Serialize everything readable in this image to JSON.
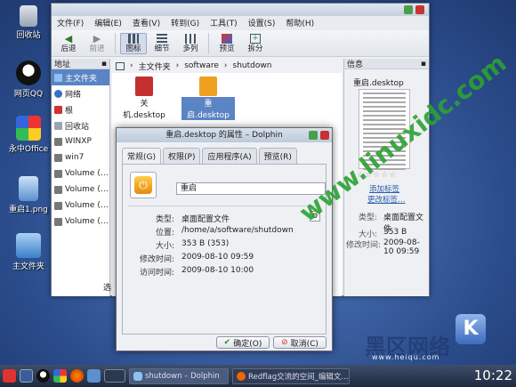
{
  "desktop": {
    "icons": [
      {
        "label": "回收站"
      },
      {
        "label": "网页QQ"
      },
      {
        "label": "永中Office"
      },
      {
        "label": "重启1.png"
      },
      {
        "label": "主文件夹"
      }
    ]
  },
  "window": {
    "menu": [
      "文件(F)",
      "编辑(E)",
      "查看(V)",
      "转到(G)",
      "工具(T)",
      "设置(S)",
      "帮助(H)"
    ],
    "toolbar": [
      "后退",
      "前进",
      "图标",
      "细节",
      "多列",
      "预览",
      "拆分"
    ],
    "places_title": "地址",
    "places": [
      "主文件夹",
      "网络",
      "根",
      "回收站",
      "WINXP",
      "win7",
      "Volume (…",
      "Volume (…",
      "Volume (…",
      "Volume (…"
    ],
    "breadcrumb": [
      "主文件夹",
      "software",
      "shutdown"
    ],
    "files": [
      {
        "name": "关机.desktop",
        "line1": "关",
        "line2": "机.desktop"
      },
      {
        "name": "重启.desktop",
        "line1": "重",
        "line2": "启.desktop"
      }
    ],
    "status_partial": "选",
    "info": {
      "title": "信息",
      "filename": "重启.desktop",
      "add_tag": "添加标签",
      "change_comment": "更改标签…",
      "type_label": "类型:",
      "type_value": "桌面配置文件",
      "size_label": "大小:",
      "size_value": "353 B",
      "modified_label": "修改时间:",
      "modified_value": "2009-08-10 09:59"
    }
  },
  "dialog": {
    "title": "重启.desktop 的属性 – Dolphin",
    "tabs": [
      "常规(G)",
      "权限(P)",
      "应用程序(A)",
      "预览(R)"
    ],
    "name_value": "重启",
    "rows": [
      {
        "label": "类型:",
        "value": "桌面配置文件"
      },
      {
        "label": "位置:",
        "value": "/home/a/software/shutdown"
      },
      {
        "label": "大小:",
        "value": "353 B (353)"
      },
      {
        "label": "修改时间:",
        "value": "2009-08-10 09:59"
      },
      {
        "label": "访问时间:",
        "value": "2009-08-10 10:00"
      }
    ],
    "ok": "确定(O)",
    "cancel": "取消(C)"
  },
  "taskbar": {
    "tasks": [
      "shutdown – Dolphin",
      "Redflag交流的空间_编辑文..."
    ],
    "clock": "10:22"
  },
  "watermark": {
    "main": "www.linuxidc.com",
    "sub": "黑区网络",
    "url": "www.heiqu.com"
  },
  "colors": {
    "desktop": "#3f64a6",
    "selection": "#5a84c4",
    "taskbar": "#26324a",
    "watermark": "#2ba233"
  }
}
